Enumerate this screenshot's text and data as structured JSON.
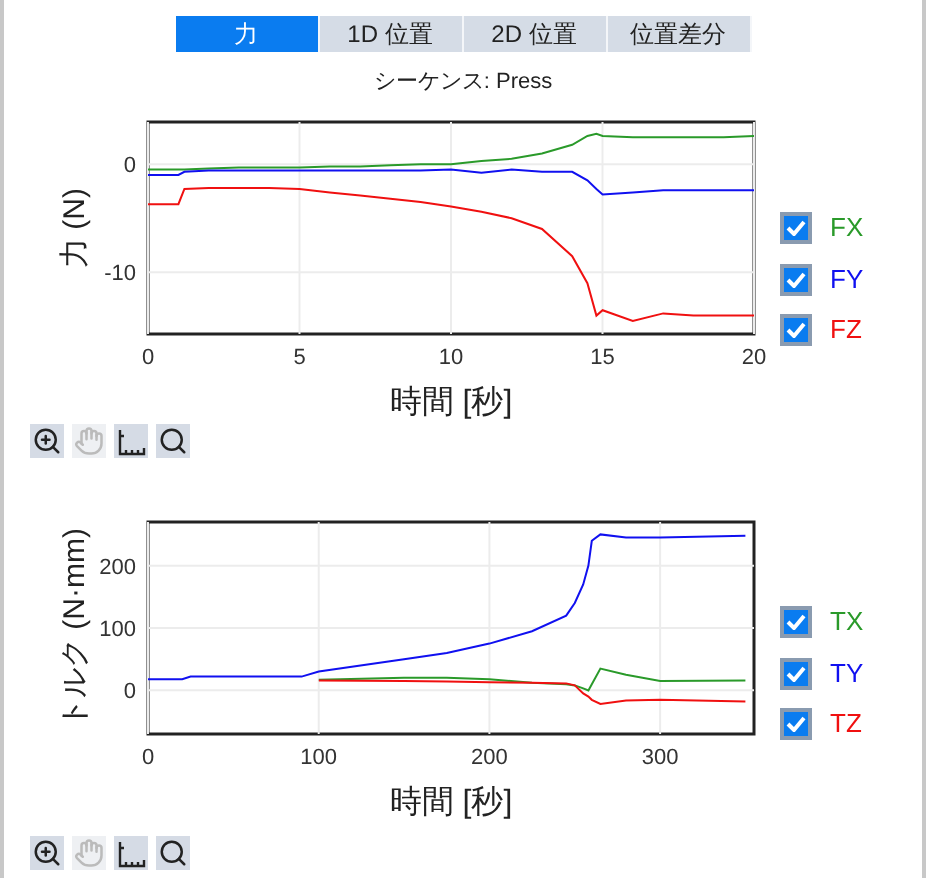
{
  "tabs": [
    {
      "label": "力",
      "selected": true
    },
    {
      "label": "1D 位置",
      "selected": false
    },
    {
      "label": "2D 位置",
      "selected": false
    },
    {
      "label": "位置差分",
      "selected": false
    }
  ],
  "sequence_label": "シーケンス: Press",
  "charts": [
    {
      "chart_data": {
        "type": "line",
        "xlabel": "時間 [秒]",
        "ylabel": "力 (N)",
        "grid": true,
        "xlim": [
          0,
          20
        ],
        "ylim": [
          -15.7,
          3.9
        ],
        "xticks": [
          0,
          5,
          10,
          15,
          20
        ],
        "yticks": [
          -10,
          0
        ],
        "x": [
          0,
          1,
          1.2,
          2,
          3,
          4,
          5,
          6,
          7,
          8,
          9,
          10,
          11,
          12,
          13,
          14,
          14.5,
          14.8,
          15,
          16,
          17,
          18,
          19,
          20
        ],
        "series": [
          {
            "name": "FX",
            "color": "#2a9a2a",
            "values": [
              -0.5,
              -0.5,
              -0.5,
              -0.4,
              -0.3,
              -0.3,
              -0.3,
              -0.2,
              -0.2,
              -0.1,
              0,
              0,
              0.3,
              0.5,
              1,
              1.8,
              2.6,
              2.8,
              2.6,
              2.5,
              2.5,
              2.5,
              2.5,
              2.6
            ]
          },
          {
            "name": "FY",
            "color": "#1010f0",
            "values": [
              -1,
              -1,
              -0.7,
              -0.6,
              -0.6,
              -0.6,
              -0.6,
              -0.6,
              -0.6,
              -0.6,
              -0.6,
              -0.5,
              -0.8,
              -0.5,
              -0.7,
              -0.7,
              -1.5,
              -2.3,
              -2.8,
              -2.6,
              -2.4,
              -2.4,
              -2.4,
              -2.4
            ]
          },
          {
            "name": "FZ",
            "color": "#f01010",
            "values": [
              -3.7,
              -3.7,
              -2.3,
              -2.2,
              -2.2,
              -2.2,
              -2.3,
              -2.6,
              -2.9,
              -3.2,
              -3.5,
              -3.9,
              -4.4,
              -5,
              -6,
              -8.5,
              -11,
              -14,
              -13.5,
              -14.5,
              -13.8,
              -14,
              -14,
              -14
            ]
          }
        ]
      },
      "legend": [
        {
          "checked": true
        },
        {
          "checked": true
        },
        {
          "checked": true
        }
      ]
    },
    {
      "chart_data": {
        "type": "line",
        "xlabel": "時間 [秒]",
        "ylabel": "トルク (N·mm)",
        "grid": true,
        "xlim": [
          0,
          355
        ],
        "ylim": [
          -70,
          270
        ],
        "xticks": [
          0,
          100,
          200,
          300
        ],
        "yticks": [
          0,
          100,
          200
        ],
        "x": [
          0,
          20,
          25,
          90,
          100,
          150,
          175,
          200,
          225,
          245,
          250,
          255,
          258,
          260,
          265,
          280,
          300,
          350
        ],
        "series": [
          {
            "name": "TX",
            "color": "#2a9a2a",
            "values": [
              null,
              null,
              null,
              null,
              17,
              20,
              20,
              18,
              12,
              10,
              8,
              3,
              0,
              10,
              35,
              25,
              15,
              16
            ]
          },
          {
            "name": "TY",
            "color": "#1010f0",
            "values": [
              18,
              18,
              22,
              22,
              30,
              50,
              60,
              75,
              95,
              120,
              140,
              170,
              200,
              240,
              250,
              245,
              245,
              248
            ]
          },
          {
            "name": "TZ",
            "color": "#f01010",
            "values": [
              null,
              null,
              null,
              null,
              16,
              15,
              14,
              13,
              12,
              11,
              8,
              -5,
              -10,
              -15,
              -22,
              -16,
              -15,
              -18
            ]
          }
        ]
      },
      "legend": [
        {
          "checked": true
        },
        {
          "checked": true
        },
        {
          "checked": true
        }
      ]
    }
  ]
}
